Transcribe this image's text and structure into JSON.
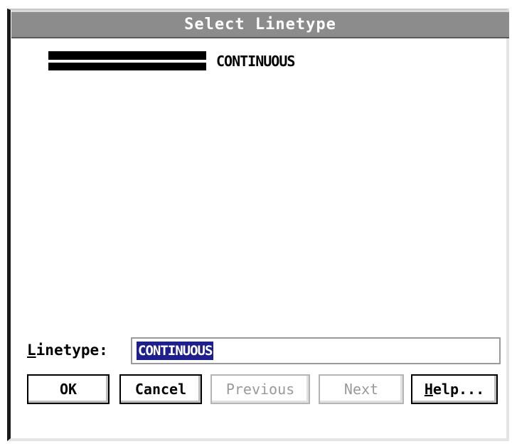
{
  "dialog": {
    "title": "Select Linetype"
  },
  "list": {
    "items": [
      {
        "label": "CONTINUOUS"
      }
    ]
  },
  "field": {
    "label_accel": "L",
    "label_rest": "inetype:",
    "value": "CONTINUOUS"
  },
  "buttons": {
    "ok": "OK",
    "cancel": "Cancel",
    "previous": "Previous",
    "next": "Next",
    "help_accel": "H",
    "help_rest": "elp..."
  }
}
